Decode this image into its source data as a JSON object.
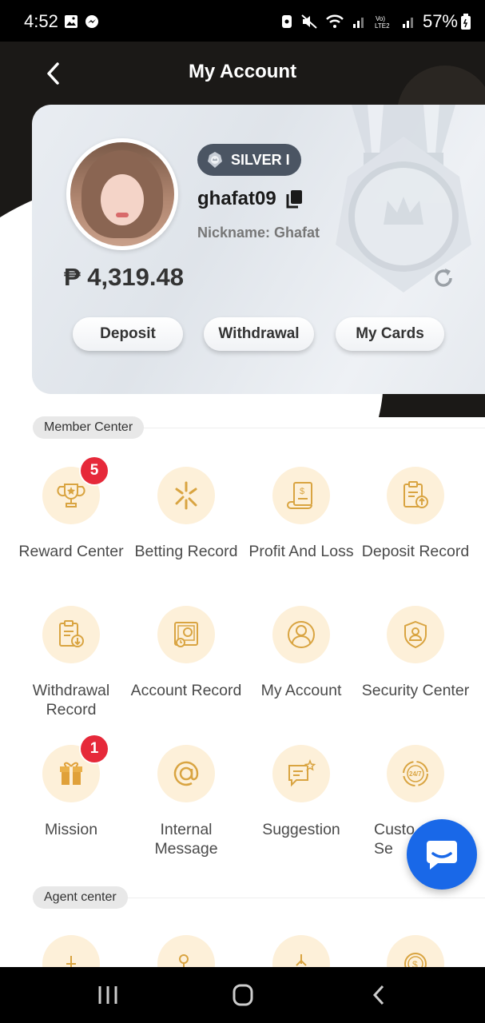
{
  "status_bar": {
    "time": "4:52",
    "battery": "57%",
    "left_icons": [
      "gallery-icon",
      "messenger-icon"
    ],
    "right_icons": [
      "screen-lock-icon",
      "mute-icon",
      "wifi-icon",
      "signal-icon",
      "volte-icon",
      "signal-2-icon"
    ]
  },
  "header": {
    "title": "My Account",
    "back_icon": "back-chevron-icon"
  },
  "profile": {
    "rank": "SILVER I",
    "username": "ghafat09",
    "nickname": "Nickname: Ghafat",
    "balance": "₱ 4,319.48"
  },
  "actions": {
    "deposit": "Deposit",
    "withdrawal": "Withdrawal",
    "my_cards": "My Cards"
  },
  "member_center": {
    "title": "Member Center",
    "items": [
      {
        "label": "Reward Center",
        "icon": "trophy-icon",
        "badge": "5"
      },
      {
        "label": "Betting Record",
        "icon": "betting-icon"
      },
      {
        "label": "Profit And Loss",
        "icon": "receipt-icon"
      },
      {
        "label": "Deposit Record",
        "icon": "clipboard-upload-icon"
      },
      {
        "label": "Withdrawal Record",
        "icon": "clipboard-download-icon"
      },
      {
        "label": "Account Record",
        "icon": "account-record-icon"
      },
      {
        "label": "My Account",
        "icon": "user-icon"
      },
      {
        "label": "Security Center",
        "icon": "shield-user-icon"
      },
      {
        "label": "Mission",
        "icon": "gift-icon",
        "badge": "1"
      },
      {
        "label": "Internal Message",
        "icon": "at-icon"
      },
      {
        "label": "Suggestion",
        "icon": "chat-star-icon"
      },
      {
        "label": "Custo Se",
        "icon": "support-24-7-icon"
      }
    ]
  },
  "agent_center": {
    "title": "Agent center",
    "icons": [
      "agent-icon-1",
      "agent-icon-2",
      "agent-icon-3",
      "agent-money-icon"
    ]
  },
  "colors": {
    "accent_gold": "#d9a441",
    "icon_bg": "#fdf0d9",
    "badge_red": "#e6293a",
    "chat_blue": "#1968e8",
    "header_dark": "#1b1917"
  }
}
